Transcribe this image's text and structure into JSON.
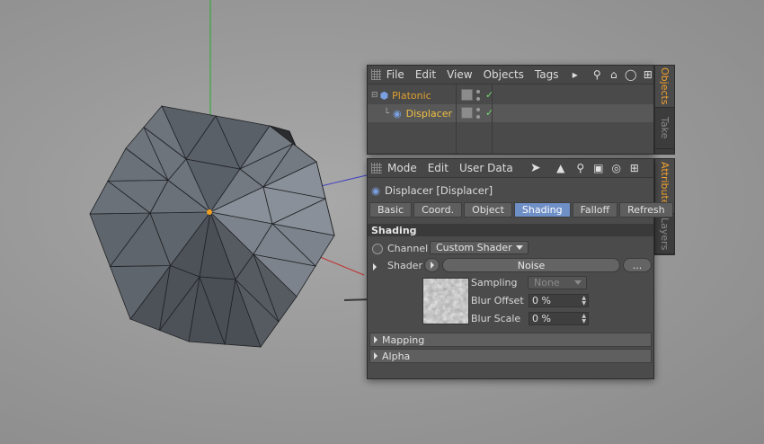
{
  "viewport": {
    "background": "#9a9a9a",
    "mesh_color": "#5b6066",
    "axis_colors": {
      "y": "#2ea82e",
      "z": "#4040c0",
      "x": "#c03030"
    },
    "pivot_color": "#f0a020"
  },
  "object_manager": {
    "menus": [
      "File",
      "Edit",
      "View",
      "Objects",
      "Tags"
    ],
    "tool_icons": [
      "play-arrow-icon",
      "search-icon",
      "home-icon",
      "eye-icon",
      "new-window-icon"
    ],
    "objects": [
      {
        "name": "Platonic",
        "color": "#e0a030"
      },
      {
        "name": "Displacer",
        "color": "#f0c040"
      }
    ]
  },
  "side_tabs_top": [
    "Objects",
    "Take"
  ],
  "side_tabs_bottom": [
    "Attributes",
    "Layers"
  ],
  "attributes": {
    "menus": [
      "Mode",
      "Edit",
      "User Data"
    ],
    "title": "Displacer [Displacer]",
    "tabs": [
      "Basic",
      "Coord.",
      "Object",
      "Shading",
      "Falloff",
      "Refresh"
    ],
    "active_tab": "Shading",
    "active_color": "#6f8fc7",
    "section": "Shading",
    "channel_label": "Channel",
    "channel_value": "Custom Shader",
    "shader_label": "Shader",
    "shader_value": "Noise",
    "shader_more": "...",
    "sampling_label": "Sampling",
    "sampling_value": "None",
    "blur_offset_label": "Blur Offset",
    "blur_offset_value": "0 %",
    "blur_scale_label": "Blur Scale",
    "blur_scale_value": "0 %",
    "groups": [
      "Mapping",
      "Alpha"
    ]
  }
}
